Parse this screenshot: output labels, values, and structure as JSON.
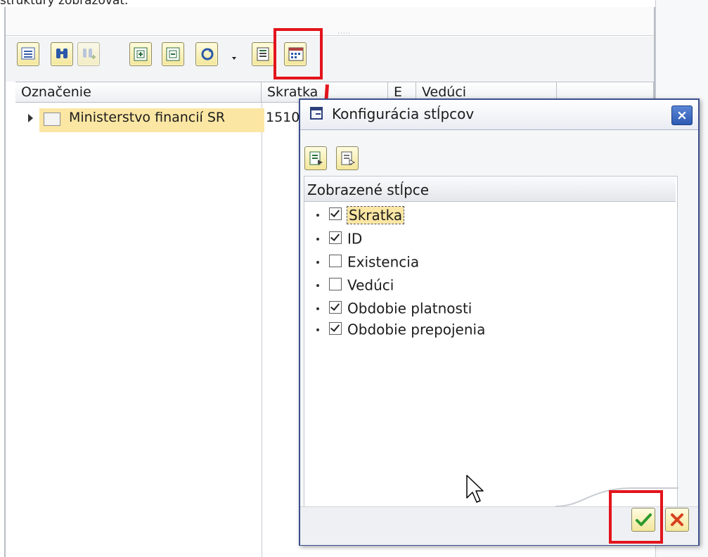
{
  "top_caption": "štruktúry zobrazovať.",
  "table": {
    "columns": [
      "Označenie",
      "Skratka",
      "E",
      "Vedúci",
      ""
    ],
    "rows": [
      {
        "label": "Ministerstvo financií SR",
        "abbr": "1510"
      }
    ]
  },
  "dialog": {
    "title": "Konfigurácia stĺpcov",
    "close_label": "×",
    "list_header": "Zobrazené stĺpce",
    "items": [
      {
        "label": "Skratka",
        "checked": true
      },
      {
        "label": "ID",
        "checked": true
      },
      {
        "label": "Existencia",
        "checked": false
      },
      {
        "label": "Vedúci",
        "checked": false
      },
      {
        "label": "Obdobie platnosti",
        "checked": true
      },
      {
        "label": "Obdobie prepojenia",
        "checked": true
      }
    ]
  },
  "icons": {
    "toolbar": [
      "list-icon",
      "binoculars-icon",
      "find-next-icon",
      "expand-node-icon",
      "collapse-node-icon",
      "refresh-icon",
      "details-icon",
      "column-config-icon"
    ],
    "dialog_toolbar": [
      "select-all-icon",
      "deselect-all-icon"
    ],
    "footer": [
      "checkmark-icon",
      "cancel-icon"
    ]
  },
  "colors": {
    "highlight_red": "#e3141c",
    "selection_yellow": "#fbe6a3",
    "dialog_border": "#3b4f8e"
  }
}
